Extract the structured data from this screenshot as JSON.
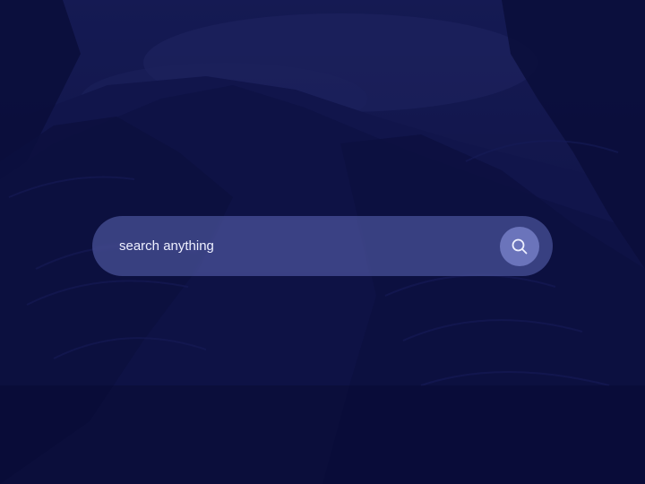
{
  "search": {
    "placeholder": "search anything",
    "value": "",
    "button_icon": "search-icon"
  },
  "background": {
    "description_icon": "forest-mountain-background"
  },
  "colors": {
    "page_background": "#0c0f3a",
    "search_bar_fill": "#5a63b8",
    "search_button_fill": "#7d86d6",
    "text": "#eef0ff"
  }
}
